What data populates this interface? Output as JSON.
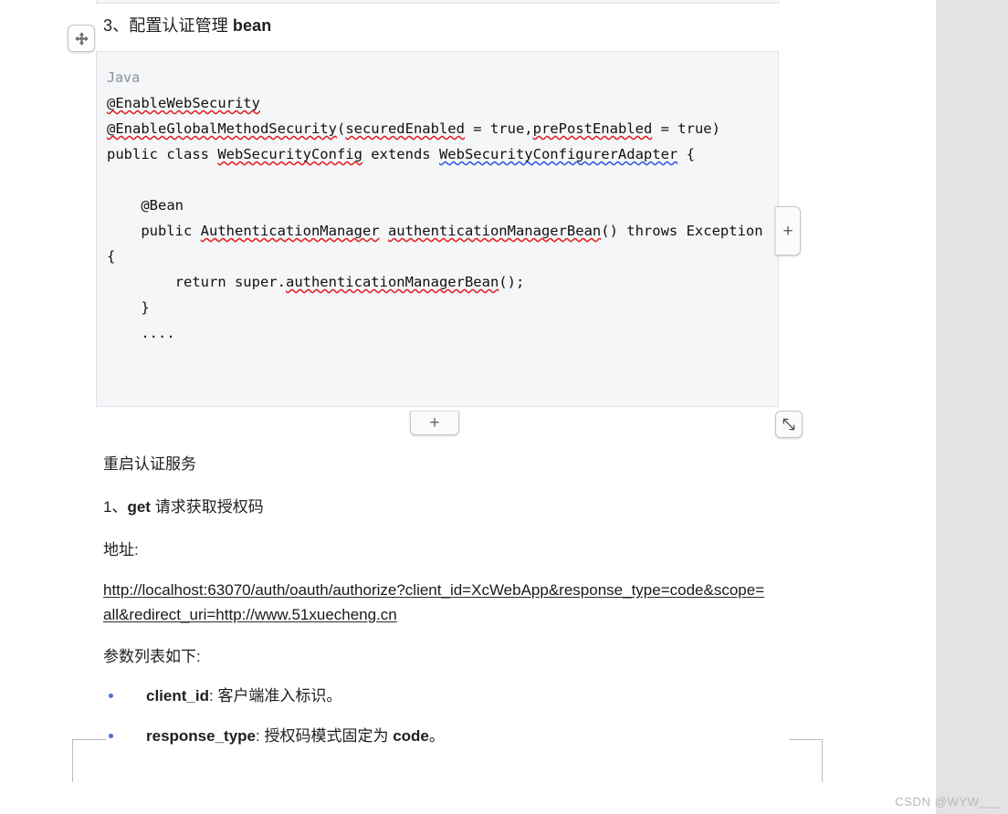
{
  "document": {
    "heading": {
      "number": "3、",
      "cn": "配置认证管理 ",
      "bold_tail": "bean"
    },
    "code_block": {
      "language_label": "Java",
      "code": "@EnableWebSecurity\n@EnableGlobalMethodSecurity(securedEnabled = true,prePostEnabled = true)\npublic class WebSecurityConfig extends WebSecurityConfigurerAdapter {\n\n    @Bean\n    public AuthenticationManager authenticationManagerBean() throws Exception {\n        return super.authenticationManagerBean();\n    }\n    ....",
      "background_color": "#f4f6f8",
      "border_color": "#dfe3e8"
    },
    "paragraphs": {
      "restart_service": "重启认证服务",
      "step_one_number": "1、",
      "step_one_bold": "get",
      "step_one_rest": " 请求获取授权码",
      "address_label": "地址:",
      "url": "http://localhost:63070/auth/oauth/authorize?client_id=XcWebApp&response_type=code&scope=all&redirect_uri=http://www.51xuecheng.cn",
      "params_intro": "参数列表如下:"
    },
    "param_list": [
      {
        "term": "client_id",
        "separator": ":",
        "desc": "客户端准入标识。"
      },
      {
        "term": "response_type",
        "separator": ":",
        "desc_pre": "授权码模式固定为 ",
        "desc_code": "code",
        "desc_post": "。"
      }
    ]
  },
  "editor_controls": {
    "move_handle": "move-handle",
    "column_add_label": "+",
    "row_add_label": "+",
    "resize_handle": "resize-handle"
  },
  "watermark": {
    "text": "CSDN @WYW___"
  },
  "colors": {
    "bullet": "#4a72c4",
    "gutter": "#e3e3e3",
    "spellcheck_underline": "#e02020",
    "code_lang_text": "#8a9099"
  }
}
